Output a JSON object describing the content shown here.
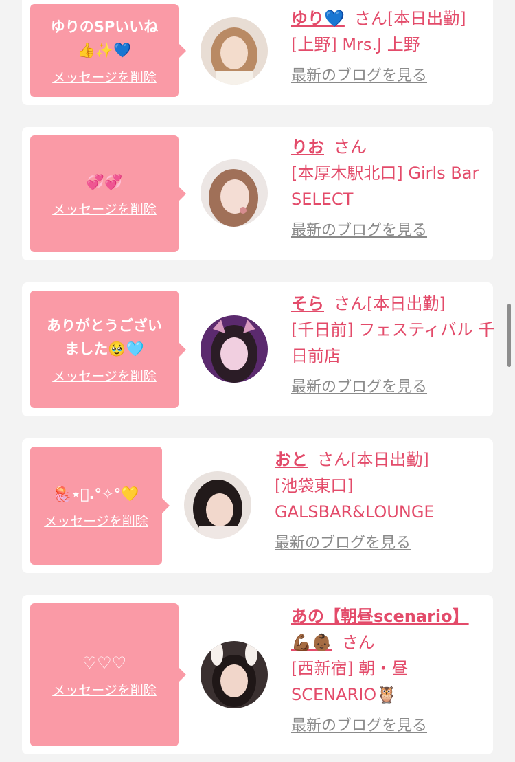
{
  "cards": [
    {
      "message": "ゆりのSPいいね\n👍✨💙",
      "delete_label": "メッセージを削除",
      "name": "ゆり💙",
      "suffix": "さん",
      "status": "[本日出勤]",
      "shop": "[上野] Mrs.J 上野",
      "blog_label": "最新のブログを見る"
    },
    {
      "message": "💞💞",
      "delete_label": "メッセージを削除",
      "name": "りお",
      "suffix": "さん",
      "status": "",
      "shop": "[本厚木駅北口] Girls Bar SELECT",
      "blog_label": "最新のブログを見る"
    },
    {
      "message": "ありがとうござい\nました🥹🩵",
      "delete_label": "メッセージを削除",
      "name": "そら",
      "suffix": "さん",
      "status": "[本日出勤]",
      "shop": "[千日前] フェスティバル 千日前店",
      "blog_label": "最新のブログを見る"
    },
    {
      "message": "🪼⋆͛.°✧°💛",
      "delete_label": "メッセージを削除",
      "name": "おと",
      "suffix": "さん",
      "status": "[本日出勤]",
      "shop": "[池袋東口] GALSBAR&LOUNGE",
      "blog_label": "最新のブログを見る"
    },
    {
      "message": "♡♡♡",
      "delete_label": "メッセージを削除",
      "name": "あの【朝昼scenario】💪🏾👶🏾",
      "suffix": "さん",
      "status": "",
      "shop": "[西新宿] 朝・昼 SCENARIO🦉",
      "blog_label": "最新のブログを見る"
    }
  ],
  "colors": {
    "background": "#f3f3f3",
    "bubble": "#fa9aa6",
    "accent": "#e34b6a",
    "link_gray": "#8a8a8a"
  }
}
